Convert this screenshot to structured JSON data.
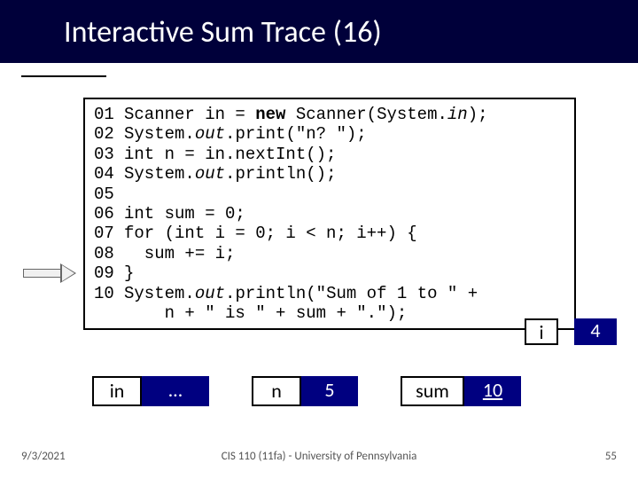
{
  "title": "Interactive Sum Trace (16)",
  "arrow_line": "09",
  "code": {
    "lines": [
      {
        "num": "01",
        "pre": "Scanner in = ",
        "kw": "new",
        "mid": " Scanner(System.",
        "it": "in",
        "post": ");"
      },
      {
        "num": "02",
        "pre": "System.",
        "it": "out",
        "mid": ".print(",
        "str": "\"n? \"",
        "post": ");"
      },
      {
        "num": "03",
        "pre": "int n = in.nextInt();"
      },
      {
        "num": "04",
        "pre": "System.",
        "it": "out",
        "mid": ".println();"
      },
      {
        "num": "05",
        "pre": ""
      },
      {
        "num": "06",
        "pre": "int sum = 0;"
      },
      {
        "num": "07",
        "pre": "for (int i = 0; i < n; i++) {"
      },
      {
        "num": "08",
        "pre": "  sum += i;"
      },
      {
        "num": "09",
        "pre": "}"
      },
      {
        "num": "10",
        "pre": "System.",
        "it": "out",
        "mid": ".println(",
        "str": "\"Sum of 1 to \"",
        "post": " +"
      },
      {
        "num": "",
        "pre": "    n + ",
        "str": "\" is \"",
        "mid": " + sum + ",
        "str2": "\".\"",
        "post": ");"
      }
    ]
  },
  "vars": {
    "i": {
      "label": "i",
      "value": "4"
    },
    "in": {
      "label": "in",
      "value": "…"
    },
    "n": {
      "label": "n",
      "value": "5"
    },
    "sum": {
      "label": "sum",
      "value": "10"
    }
  },
  "footer": {
    "date": "9/3/2021",
    "center": "CIS 110 (11fa) - University of Pennsylvania",
    "page": "55"
  }
}
